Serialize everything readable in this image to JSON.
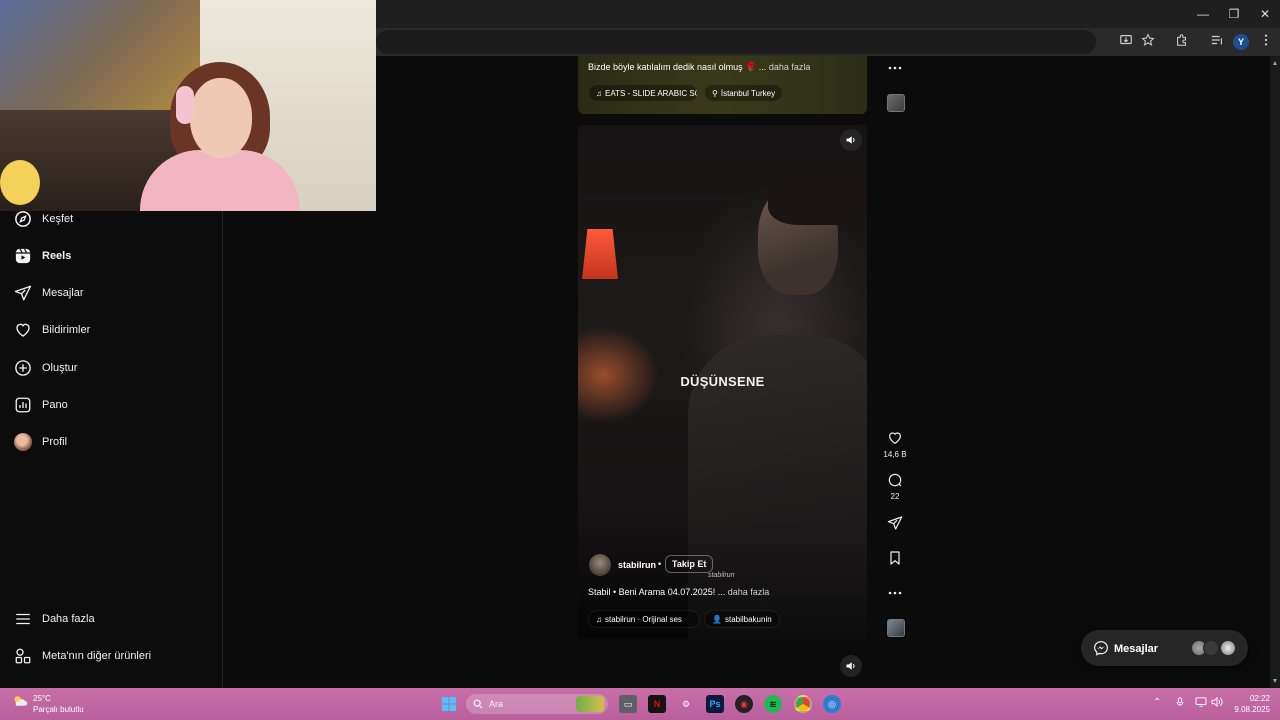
{
  "window": {
    "minimize_glyph": "—",
    "restore_glyph": "❐",
    "close_glyph": "✕"
  },
  "browser": {
    "profile_initial": "Y"
  },
  "sidebar": {
    "items": [
      {
        "label": "Keşfet",
        "icon": "compass-icon"
      },
      {
        "label": "Reels",
        "icon": "reels-icon",
        "active": true
      },
      {
        "label": "Mesajlar",
        "icon": "send-icon"
      },
      {
        "label": "Bildirimler",
        "icon": "heart-icon"
      },
      {
        "label": "Oluştur",
        "icon": "plus-square-icon"
      },
      {
        "label": "Pano",
        "icon": "chart-icon"
      },
      {
        "label": "Profil",
        "icon": "avatar"
      }
    ],
    "bottom_items": [
      {
        "label": "Daha fazla",
        "icon": "hamburger-icon"
      },
      {
        "label": "Meta'nın diğer ürünleri",
        "icon": "grid-icon"
      }
    ]
  },
  "previous_reel": {
    "caption": "Bizde böyle katılalım dedik nasıl olmuş 🌹 ...",
    "more_label": "daha fazla",
    "audio_chip": "EATS - SLIDE ARABIC SOC",
    "location_chip": "İstanbul Turkey"
  },
  "current_reel": {
    "subtitle": "DÜŞÜNSENE",
    "author": "stabilrun",
    "separator": "•",
    "follow_label": "Takip Et",
    "watermark": "stabilrun",
    "caption": "Stabil • Beni Arama 04.07.2025! ...",
    "more_label": "daha fazla",
    "audio_chip": "stabilrun · Orijinal ses",
    "tag_chip": "stabilbakunin"
  },
  "actions": {
    "likes": "14,6 B",
    "comments": "22"
  },
  "messages_pill": {
    "label": "Mesajlar"
  },
  "taskbar": {
    "weather_temp": "25°C",
    "weather_desc": "Parçalı bulutlu",
    "search_placeholder": "Ara",
    "time": "02:22",
    "date": "9.08.2025",
    "accent": "#c86ea8"
  }
}
